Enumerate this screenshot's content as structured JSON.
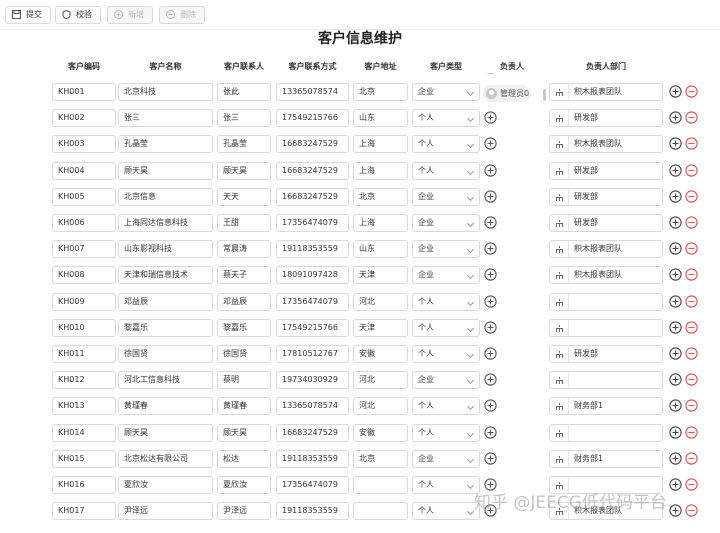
{
  "toolbar": {
    "submit_label": "提交",
    "validate_label": "校验",
    "add_label": "新增",
    "delete_label": "删除"
  },
  "page": {
    "title": "客户信息维护"
  },
  "columns": [
    "客户编码",
    "客户名称",
    "客户联系人",
    "客户联系方式",
    "客户地址",
    "客户类型",
    "负责人",
    "负责人部门"
  ],
  "owner_chip": "管理员0",
  "rows": [
    {
      "code": "KH001",
      "name": "北京科技",
      "contact": "张此",
      "phone": "13365078574",
      "addr": "北京",
      "type": "企业",
      "dept": "积木报表团队"
    },
    {
      "code": "KH002",
      "name": "张三",
      "contact": "张三",
      "phone": "17549215766",
      "addr": "山东",
      "type": "个人",
      "dept": "研发部"
    },
    {
      "code": "KH003",
      "name": "孔晶莹",
      "contact": "孔晶莹",
      "phone": "16683247529",
      "addr": "上海",
      "type": "个人",
      "dept": "积木报表团队"
    },
    {
      "code": "KH004",
      "name": "顾天昊",
      "contact": "顾天昊",
      "phone": "16683247529",
      "addr": "上海",
      "type": "个人",
      "dept": "研发部"
    },
    {
      "code": "KH005",
      "name": "北京信息",
      "contact": "天天",
      "phone": "16683247529",
      "addr": "北京",
      "type": "企业",
      "dept": "研发部"
    },
    {
      "code": "KH006",
      "name": "上海同达信息科技",
      "contact": "王甜",
      "phone": "17356474079",
      "addr": "上海",
      "type": "企业",
      "dept": "研发部"
    },
    {
      "code": "KH007",
      "name": "山东影视科技",
      "contact": "常晨涛",
      "phone": "19118353559",
      "addr": "山东",
      "type": "企业",
      "dept": "积木报表团队"
    },
    {
      "code": "KH008",
      "name": "天津和瑞信息技术",
      "contact": "蔡夫子",
      "phone": "18091097428",
      "addr": "天津",
      "type": "企业",
      "dept": "积木报表团队"
    },
    {
      "code": "KH009",
      "name": "邓益辰",
      "contact": "邓益辰",
      "phone": "17356474079",
      "addr": "河北",
      "type": "个人",
      "dept": ""
    },
    {
      "code": "KH010",
      "name": "黎嘉乐",
      "contact": "黎嘉乐",
      "phone": "17549215766",
      "addr": "天津",
      "type": "个人",
      "dept": ""
    },
    {
      "code": "KH011",
      "name": "徐国贤",
      "contact": "徐国贤",
      "phone": "17810512767",
      "addr": "安徽",
      "type": "个人",
      "dept": "研发部"
    },
    {
      "code": "KH012",
      "name": "河北工信息科技",
      "contact": "蔡明",
      "phone": "19734030929",
      "addr": "河北",
      "type": "企业",
      "dept": ""
    },
    {
      "code": "KH013",
      "name": "黄瑾春",
      "contact": "黄瑾春",
      "phone": "13365078574",
      "addr": "河北",
      "type": "个人",
      "dept": "财务部1"
    },
    {
      "code": "KH014",
      "name": "顾天昊",
      "contact": "顾天昊",
      "phone": "16683247529",
      "addr": "安徽",
      "type": "个人",
      "dept": ""
    },
    {
      "code": "KH015",
      "name": "北京松达有限公司",
      "contact": "松达",
      "phone": "19118353559",
      "addr": "北京",
      "type": "企业",
      "dept": "财务部1"
    },
    {
      "code": "KH016",
      "name": "夏欣汝",
      "contact": "夏欣汝",
      "phone": "17356474079",
      "addr": "",
      "type": "个人",
      "dept": ""
    },
    {
      "code": "KH017",
      "name": "尹泽远",
      "contact": "尹泽远",
      "phone": "19118353559",
      "addr": "",
      "type": "个人",
      "dept": "积木报表团队"
    }
  ],
  "watermark": "知乎 @JEECG低代码平台"
}
